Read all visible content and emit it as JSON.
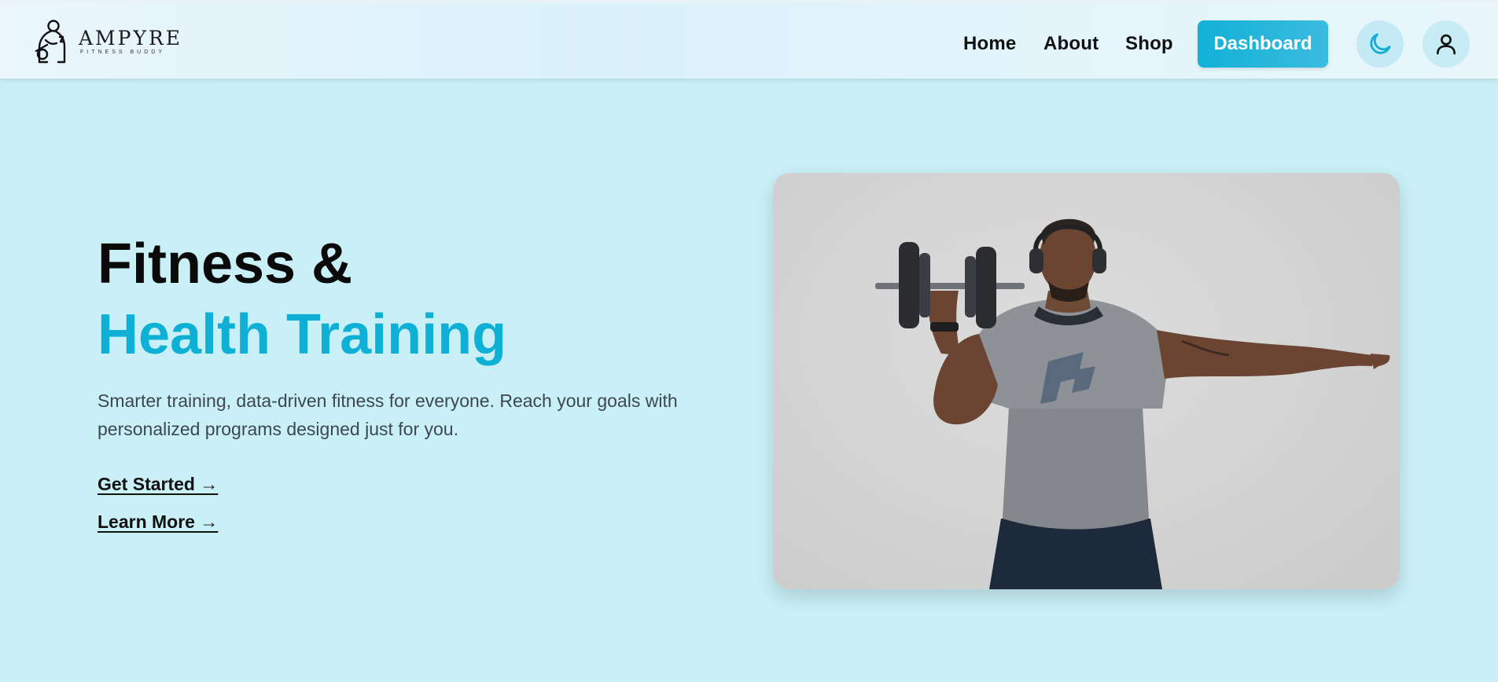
{
  "brand": {
    "name": "AMPYRE",
    "tagline": "FITNESS BUDDY"
  },
  "nav": {
    "links": [
      "Home",
      "About",
      "Shop"
    ],
    "dashboard_label": "Dashboard",
    "theme_icon": "moon-icon",
    "profile_icon": "user-icon"
  },
  "hero": {
    "title_line1": "Fitness &",
    "title_line2": "Health Training",
    "description": "Smarter training, data-driven fitness for everyone. Reach your goals with personalized programs designed just for you.",
    "cta_primary": "Get Started →",
    "cta_secondary": "Learn More →",
    "image_icon": "athlete-dumbbell-photo"
  },
  "colors": {
    "accent": "#0fb0d6",
    "background": "#c9eff7",
    "text": "#0a0a0a"
  }
}
